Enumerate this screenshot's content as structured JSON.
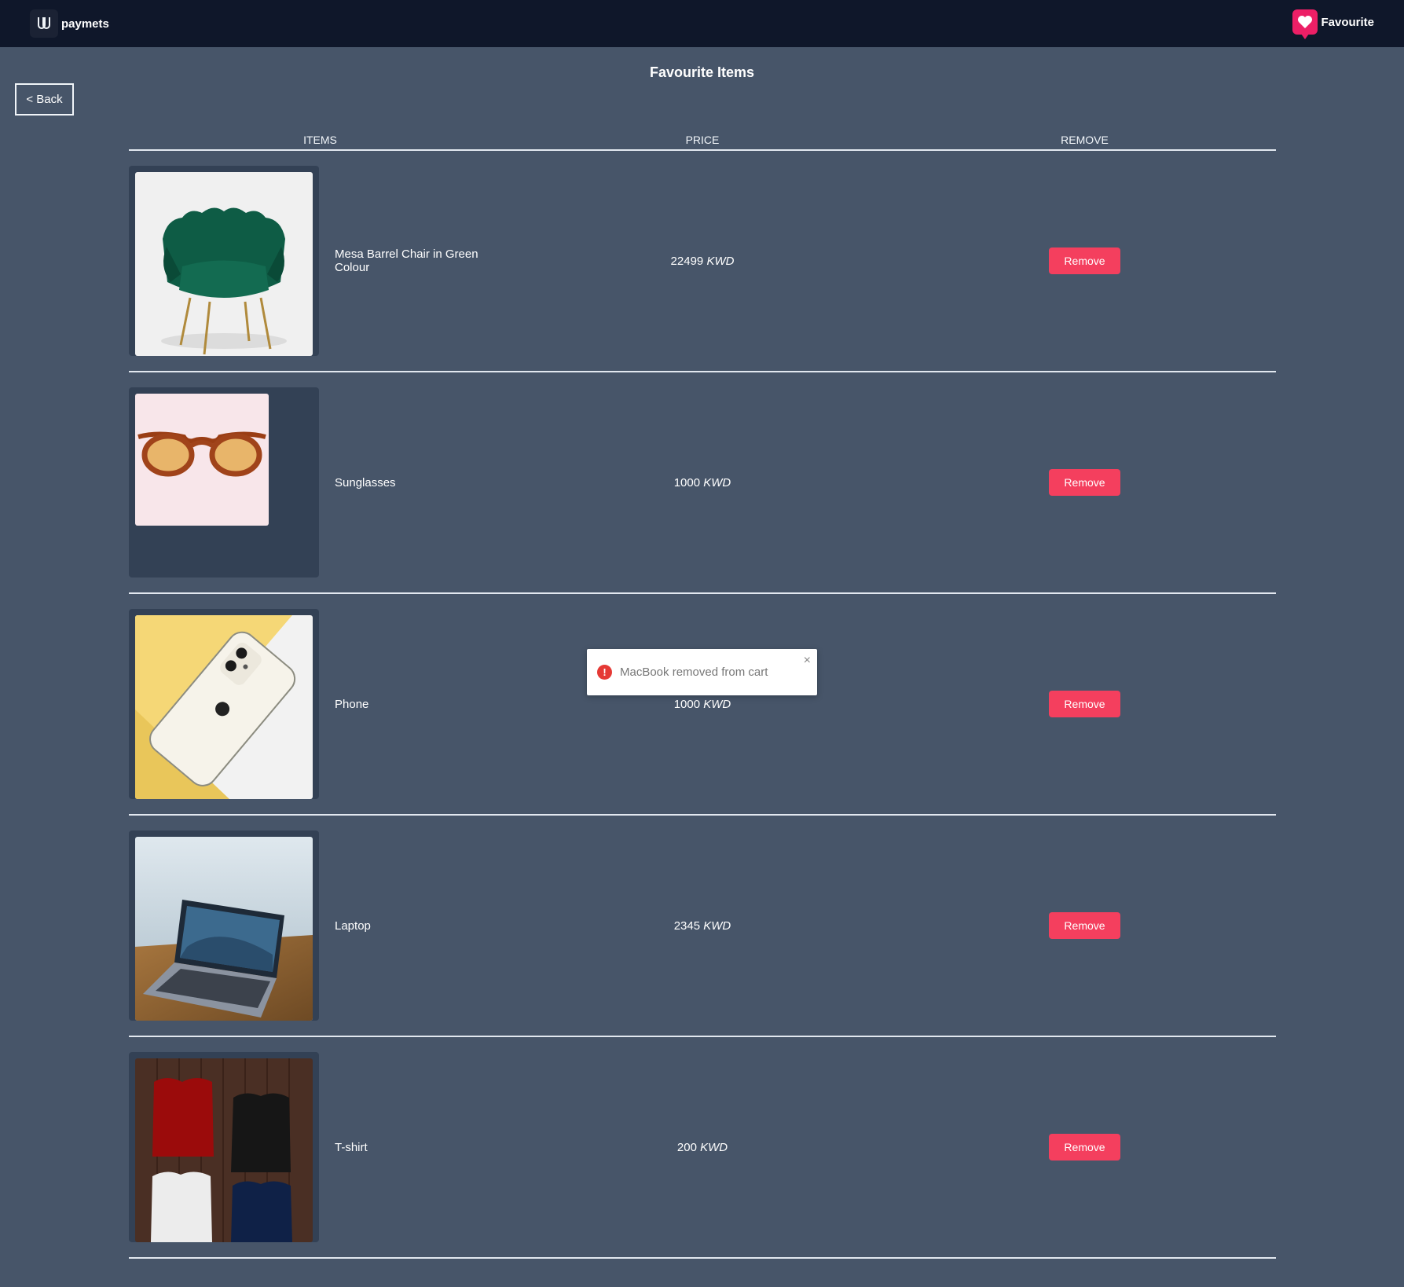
{
  "app": {
    "brand_name": "paymets",
    "favourite_label": "Favourite",
    "page_title": "Favourite Items",
    "back_label": "< Back",
    "accent_color": "#f43f5e",
    "nav_color": "#0f172a",
    "bg_color": "#475569"
  },
  "table": {
    "headers": {
      "items": "ITEMS",
      "price": "PRICE",
      "remove": "REMOVE"
    },
    "rows": [
      {
        "name": "Mesa Barrel Chair in Green Colour",
        "price": "22499",
        "currency": "KWD",
        "remove_label": "Remove",
        "image": "green-velvet-chair"
      },
      {
        "name": "Sunglasses",
        "price": "1000",
        "currency": "KWD",
        "remove_label": "Remove",
        "image": "tortoiseshell-sunglasses"
      },
      {
        "name": "Phone",
        "price": "1000",
        "currency": "KWD",
        "remove_label": "Remove",
        "image": "white-smartphone"
      },
      {
        "name": "Laptop",
        "price": "2345",
        "currency": "KWD",
        "remove_label": "Remove",
        "image": "laptop-on-desk"
      },
      {
        "name": "T-shirt",
        "price": "200",
        "currency": "KWD",
        "remove_label": "Remove",
        "image": "folded-tshirts"
      }
    ]
  },
  "toast": {
    "message": "MacBook removed from cart",
    "icon": "error-icon",
    "close_icon": "close-icon"
  }
}
